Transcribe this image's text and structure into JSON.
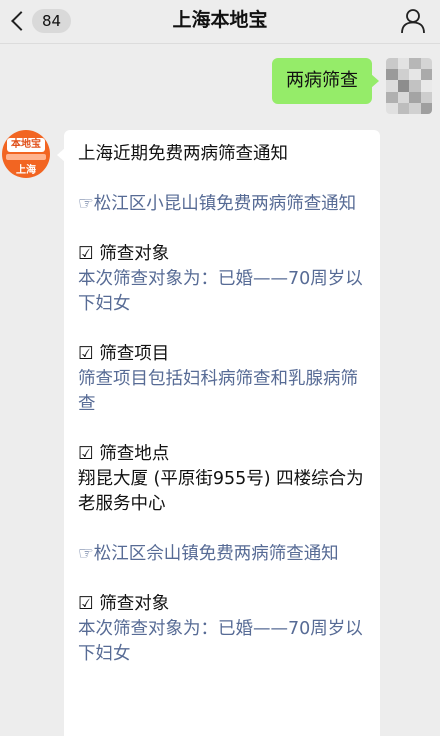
{
  "header": {
    "back_count": "84",
    "title": "上海本地宝"
  },
  "outgoing": {
    "text": "两病筛查"
  },
  "brand_avatar": {
    "top_text": "本地宝",
    "bottom_text": "上海"
  },
  "message": {
    "title": "上海近期免费两病筛查通知",
    "section1_link": "☞松江区小昆山镇免费两病筛查通知",
    "s1_target_head": "☑ 筛查对象",
    "s1_target_text": "本次筛查对象为：已婚——70周岁以下妇女",
    "s1_items_head": "☑ 筛查项目",
    "s1_items_text": "筛查项目包括妇科病筛查和乳腺病筛查",
    "s1_place_head": "☑ 筛查地点",
    "s1_place_text": "翔昆大厦 (平原街955号) 四楼综合为老服务中心",
    "section2_link": "☞松江区佘山镇免费两病筛查通知",
    "s2_target_head": "☑ 筛查对象",
    "s2_target_text": "本次筛查对象为：已婚——70周岁以下妇女"
  },
  "colors": {
    "link": "#576b95",
    "outgoing_bubble": "#95ec69",
    "brand": "#f26522"
  }
}
